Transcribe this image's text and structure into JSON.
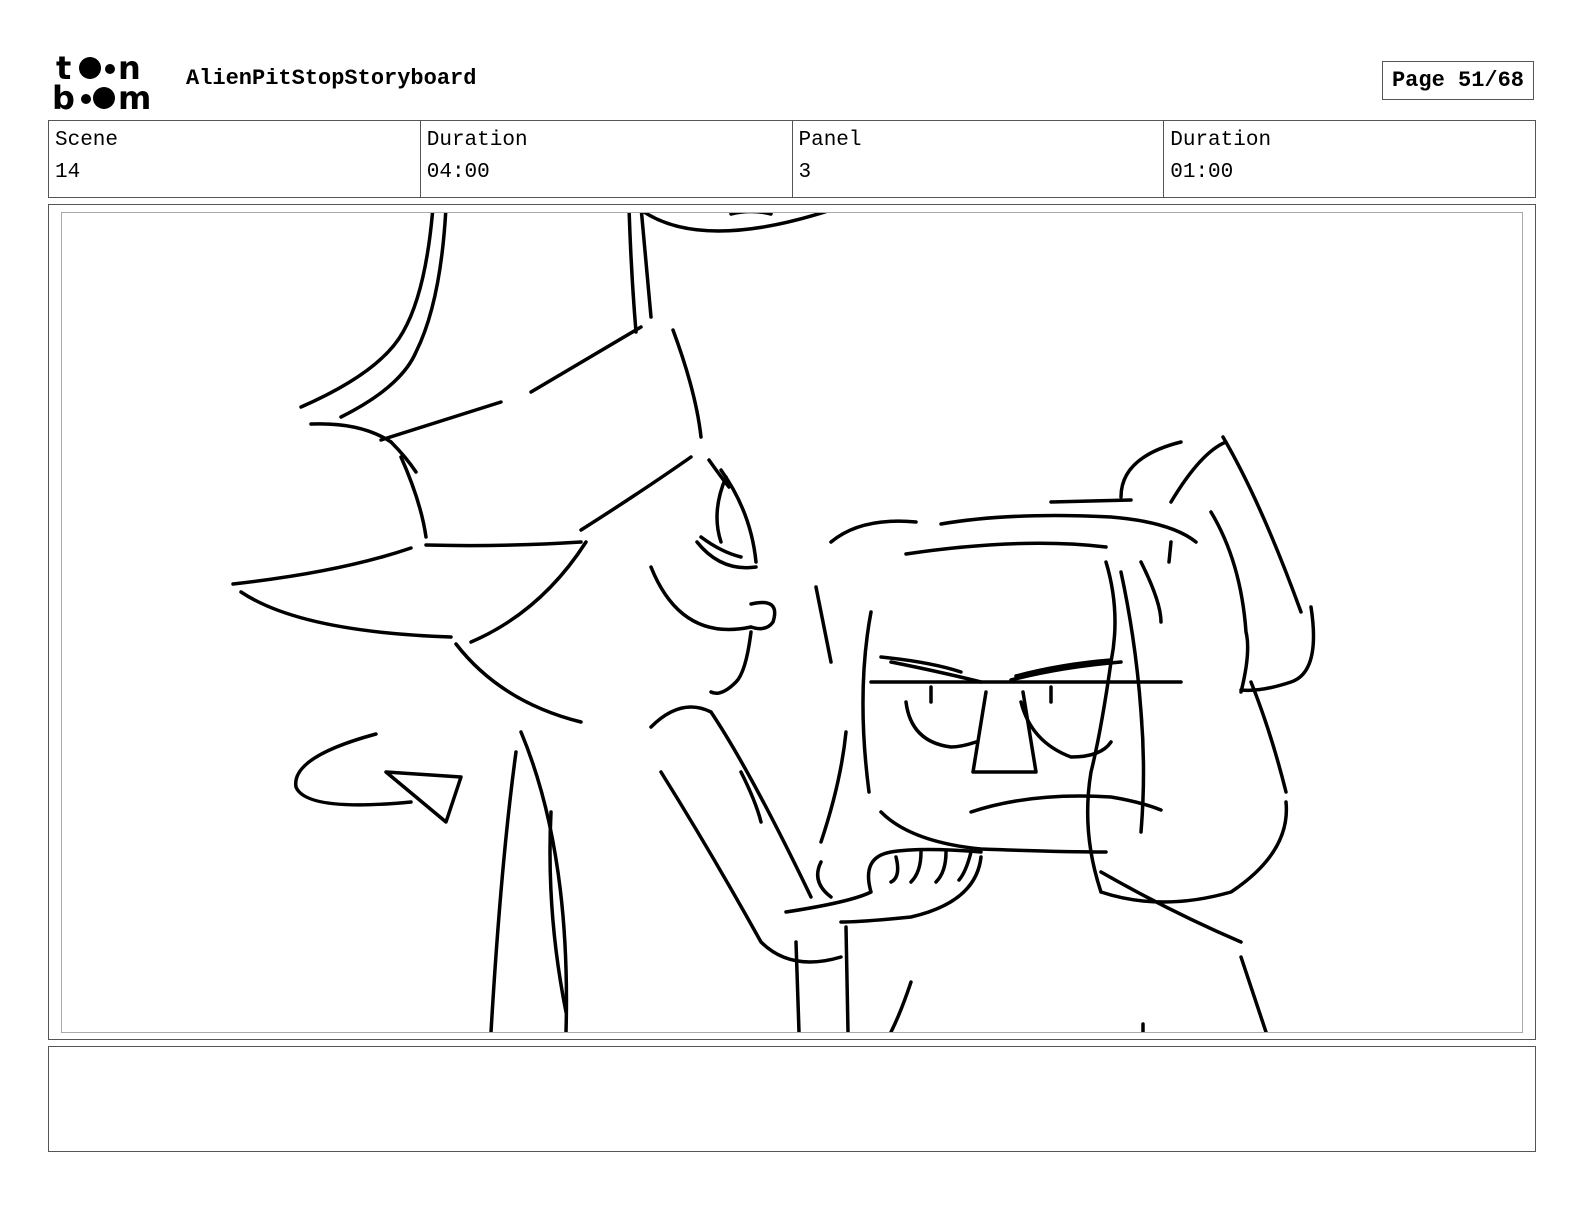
{
  "header": {
    "logo_text_top": "toon",
    "logo_text_bottom": "boom",
    "project_title": "AlienPitStopStoryboard",
    "page_label": "Page 51/68"
  },
  "info": {
    "scene_label": "Scene",
    "scene_value": "14",
    "scene_duration_label": "Duration",
    "scene_duration_value": "04:00",
    "panel_label": "Panel",
    "panel_value": "3",
    "panel_duration_label": "Duration",
    "panel_duration_value": "01:00"
  },
  "panel": {
    "sketch": "line-drawing-two-characters"
  },
  "notes": {
    "text": ""
  }
}
